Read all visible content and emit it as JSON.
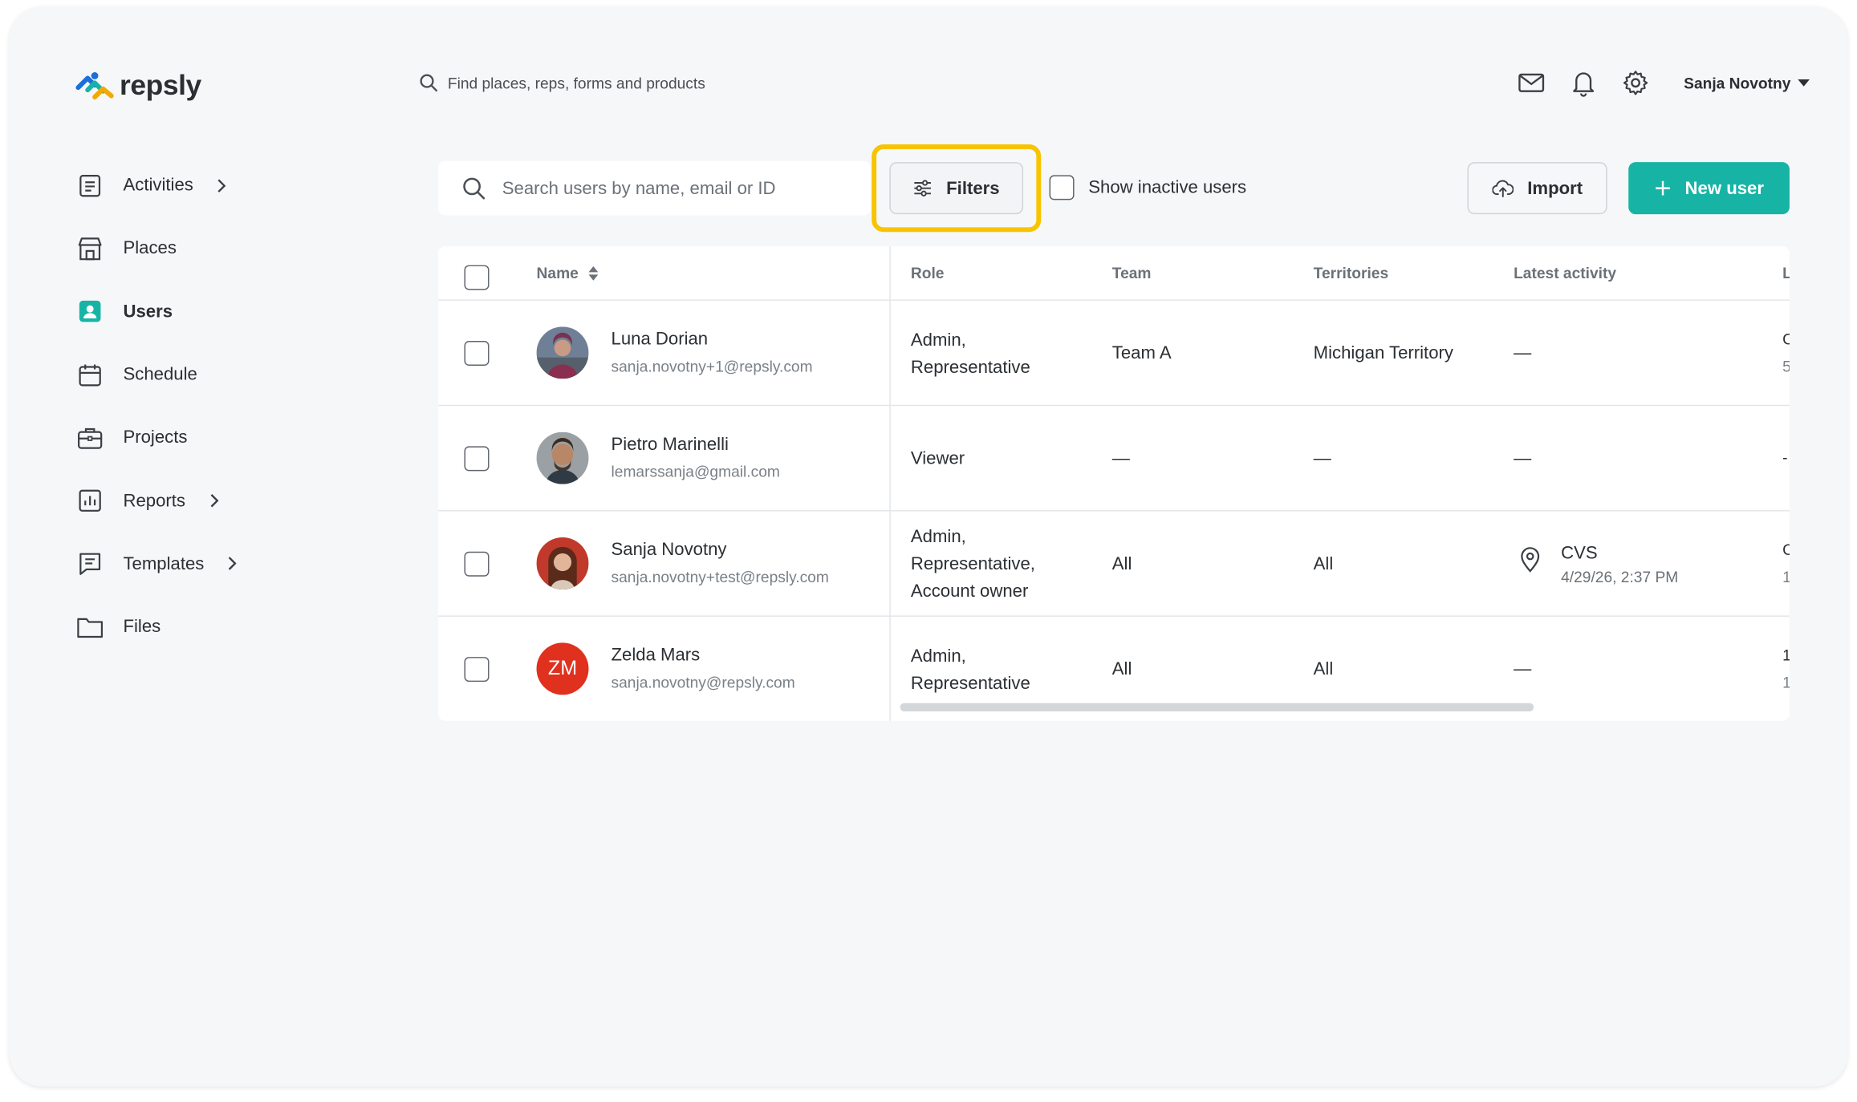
{
  "app": {
    "logo_text": "repsly",
    "global_search_placeholder": "Find places, reps, forms and products",
    "user_name": "Sanja Novotny"
  },
  "header_icons": [
    "mail-icon",
    "bell-icon",
    "gear-icon"
  ],
  "sidebar": {
    "items": [
      {
        "label": "Activities",
        "icon": "clipboard-icon",
        "has_chevron": true,
        "active": false
      },
      {
        "label": "Places",
        "icon": "store-icon",
        "has_chevron": false,
        "active": false
      },
      {
        "label": "Users",
        "icon": "user-badge-icon",
        "has_chevron": false,
        "active": true
      },
      {
        "label": "Schedule",
        "icon": "calendar-icon",
        "has_chevron": false,
        "active": false
      },
      {
        "label": "Projects",
        "icon": "briefcase-icon",
        "has_chevron": false,
        "active": false
      },
      {
        "label": "Reports",
        "icon": "chart-icon",
        "has_chevron": true,
        "active": false
      },
      {
        "label": "Templates",
        "icon": "template-icon",
        "has_chevron": true,
        "active": false
      },
      {
        "label": "Files",
        "icon": "folder-icon",
        "has_chevron": false,
        "active": false
      }
    ]
  },
  "toolbar": {
    "search_placeholder": "Search users by name, email or ID",
    "filters_label": "Filters",
    "show_inactive_label": "Show inactive users",
    "import_label": "Import",
    "new_user_label": "New user"
  },
  "table": {
    "columns": {
      "name": "Name",
      "role": "Role",
      "team": "Team",
      "territories": "Territories",
      "latest_activity": "Latest activity",
      "cut_column": "L"
    },
    "rows": [
      {
        "name": "Luna Dorian",
        "email": "sanja.novotny+1@repsly.com",
        "role_lines": [
          "Admin,",
          "Representative"
        ],
        "team": "Team A",
        "territories": "Michigan Territory",
        "latest_activity": "—",
        "cut_top": "C",
        "cut_bottom": "5"
      },
      {
        "name": "Pietro Marinelli",
        "email": "lemarssanja@gmail.com",
        "role_lines": [
          "Viewer"
        ],
        "team": "—",
        "territories": "—",
        "latest_activity": "—",
        "cut_top": "-",
        "cut_bottom": ""
      },
      {
        "name": "Sanja Novotny",
        "email": "sanja.novotny+test@repsly.com",
        "role_lines": [
          "Admin,",
          "Representative,",
          "Account owner"
        ],
        "team": "All",
        "territories": "All",
        "latest_activity_place": "CVS",
        "latest_activity_time": "4/29/26, 2:37 PM",
        "cut_top": "C",
        "cut_bottom": "1"
      },
      {
        "name": "Zelda Mars",
        "email": "sanja.novotny@repsly.com",
        "initials": "ZM",
        "role_lines": [
          "Admin,",
          "Representative"
        ],
        "team": "All",
        "territories": "All",
        "latest_activity": "—",
        "cut_top": "1",
        "cut_bottom": "1"
      }
    ]
  },
  "colors": {
    "accent": "#17b4a6",
    "highlight": "#f8c400",
    "initials_avatar": "#e0301e"
  }
}
